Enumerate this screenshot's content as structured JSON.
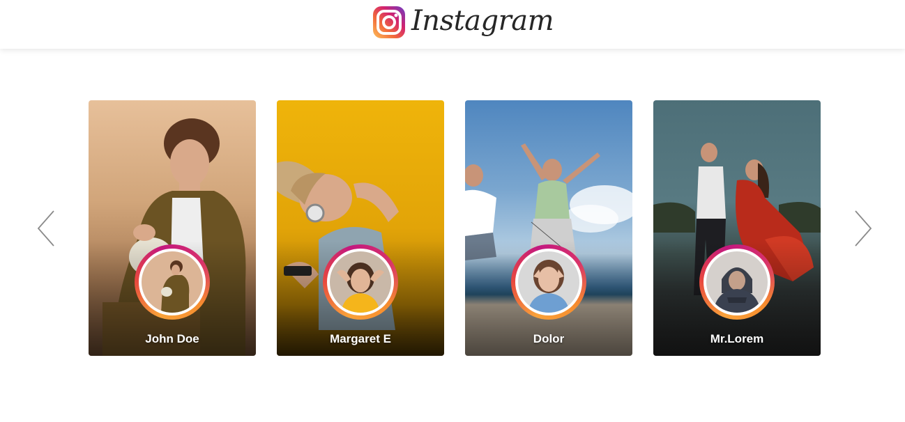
{
  "header": {
    "brand_name": "Instagram",
    "logo_icon": "instagram-logo-icon"
  },
  "carousel": {
    "prev_icon": "chevron-left-icon",
    "next_icon": "chevron-right-icon",
    "stories": [
      {
        "name": "John Doe"
      },
      {
        "name": "Margaret E"
      },
      {
        "name": "Dolor"
      },
      {
        "name": "Mr.Lorem"
      }
    ]
  },
  "colors": {
    "ring_orange": "#f9a23a",
    "ring_pink": "#c3187f",
    "ring_red": "#e8483e",
    "arrow": "#8a8a8a"
  }
}
